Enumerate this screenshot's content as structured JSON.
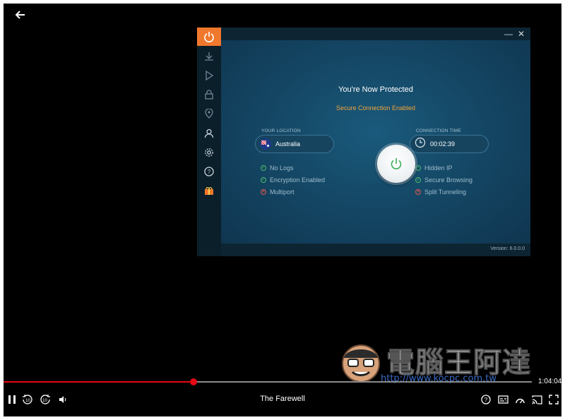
{
  "player": {
    "movie_title": "The Farewell",
    "time_remaining": "1:04:04",
    "progress": 0.36,
    "buffered": 0.38
  },
  "vpn": {
    "status_title": "You're Now Protected",
    "status_subtitle": "Secure Connection Enabled",
    "location_label": "YOUR LOCATION",
    "location_value": "Australia",
    "time_label": "CONNECTION TIME",
    "time_value": "00:02:39",
    "left_features": [
      {
        "label": "No Logs",
        "enabled": true
      },
      {
        "label": "Encryption Enabled",
        "enabled": true
      },
      {
        "label": "Multiport",
        "enabled": false
      }
    ],
    "right_features": [
      {
        "label": "Hidden IP",
        "enabled": true
      },
      {
        "label": "Secure Browsing",
        "enabled": true
      },
      {
        "label": "Split Tunneling",
        "enabled": false
      }
    ],
    "version": "Version: 6.0.0.0",
    "sidebar_icons": [
      "power-icon",
      "download-icon",
      "play-icon",
      "lock-icon",
      "location-pin-icon",
      "user-icon",
      "gear-icon",
      "help-icon",
      "gift-icon"
    ]
  },
  "watermark": {
    "text": "電腦王阿達",
    "url": "http://www.kocpc.com.tw"
  },
  "colors": {
    "accent": "#f0782d",
    "progress": "#e50914",
    "secure": "#f2a33a"
  }
}
